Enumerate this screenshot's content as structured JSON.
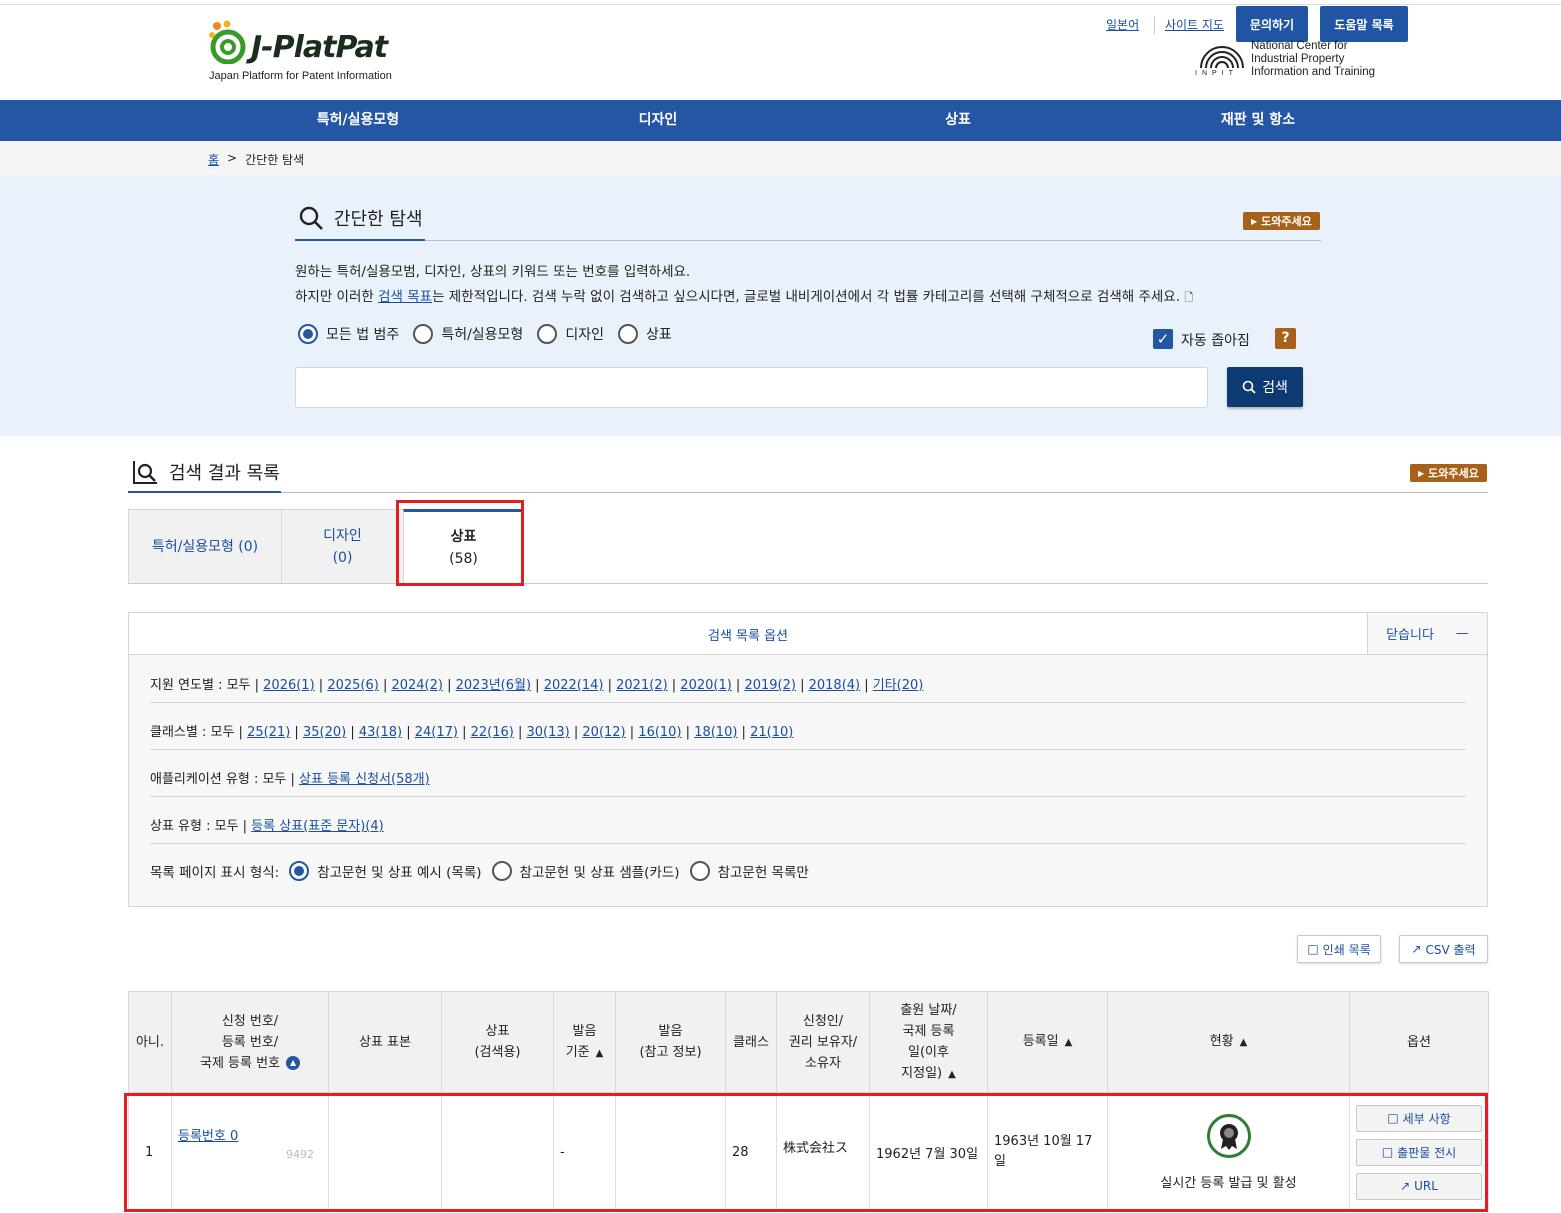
{
  "header": {
    "logo_text": "J-PlatPat",
    "logo_sub": "Japan Platform for Patent Information",
    "links": [
      "일본어",
      "사이트 지도"
    ],
    "buttons": [
      "문의하기",
      "도움말 목록"
    ],
    "inpit_lines": [
      "National Center for",
      "Industrial Property",
      "Information and Training"
    ],
    "inpit_label": "INPIT"
  },
  "nav": [
    "특허/실용모형",
    "디자인",
    "상표",
    "재판 및 항소"
  ],
  "breadcrumb": {
    "home": "홈",
    "current": "간단한 탐색"
  },
  "simple_search": {
    "title": "간단한 탐색",
    "help": "도와주세요",
    "desc1": "원하는 특허/실용모범, 디자인, 상표의 키워드 또는 번호를 입력하세요.",
    "desc2_pre": "하지만 이러한 ",
    "desc2_link": "검색 목표",
    "desc2_post": "는 제한적입니다. 검색 누락 없이 검색하고 싶으시다면, 글로벌 내비게이션에서 각 법률 카테고리를 선택해 구체적으로 검색해 주세요.",
    "radios": [
      "모든 법 범주",
      "특허/실용모형",
      "디자인",
      "상표"
    ],
    "selected_radio": 0,
    "auto_zoom": "자동 좁아짐",
    "qmark": "?",
    "input_value": "",
    "search_btn": "검색"
  },
  "results": {
    "title": "검색 결과 목록",
    "help": "도와주세요",
    "tabs": [
      {
        "label": "특허/실용모형 (0)"
      },
      {
        "label": "디자인",
        "count": "(0)"
      },
      {
        "label": "상표",
        "count": "(58)"
      }
    ],
    "active_tab": 2,
    "options": {
      "title": "검색 목록 옵션",
      "close": "닫습니다",
      "close_icon": "—",
      "year": {
        "label": "지원 연도별 : 모두 | ",
        "items": [
          "2026(1)",
          "2025(6)",
          "2024(2)",
          "2023년(6월)",
          "2022(14)",
          "2021(2)",
          "2020(1)",
          "2019(2)",
          "2018(4)",
          "기타(20)"
        ]
      },
      "class": {
        "label": "클래스별 : 모두 | ",
        "items": [
          "25(21)",
          "35(20)",
          "43(18)",
          "24(17)",
          "22(16)",
          "30(13)",
          "20(12)",
          "16(10)",
          "18(10)",
          "21(10)"
        ]
      },
      "app_type": {
        "label": "애플리케이션 유형 : 모두 | ",
        "items": [
          "상표 등록 신청서(58개)"
        ]
      },
      "mark_type": {
        "label": "상표 유형 : 모두 | ",
        "items": [
          "등록 상표(표준 문자)(4)"
        ]
      },
      "format": {
        "label": "목록 페이지 표시 형식:",
        "items": [
          "참고문헌 및 상표 예시 (목록)",
          "참고문헌 및 상표 샘플(카드)",
          "참고문헌 목록만"
        ],
        "selected": 0
      }
    },
    "print_btn": "인쇄 목록",
    "csv_btn": "CSV 출력",
    "table": {
      "headers": [
        "아니.",
        "신청 번호/\n등록 번호/\n국제 등록 번호",
        "상표 표본",
        "상표\n(검색용)",
        "발음\n기준",
        "발음\n(참고 정보)",
        "클래스",
        "신청인/\n권리 보유자/\n소유자",
        "출원 날짜/\n국제 등록\n일(이후\n지정일)",
        "등록일",
        "현황",
        "옵션"
      ],
      "rows": [
        {
          "no": "1",
          "reg_no": "등록번호 0",
          "reg_no_tail": "9492",
          "sample": "",
          "search_mark": "",
          "pron_basis": "-",
          "pron_ref": "",
          "class": "28",
          "applicant": "株式会社ス",
          "filing_date": "1962년 7월 30일",
          "reg_date": "1963년 10월 17일",
          "status": "실시간 등록 발급 및 활성",
          "options": [
            "세부 사항",
            "출판물 전시",
            "URL"
          ]
        }
      ]
    }
  }
}
